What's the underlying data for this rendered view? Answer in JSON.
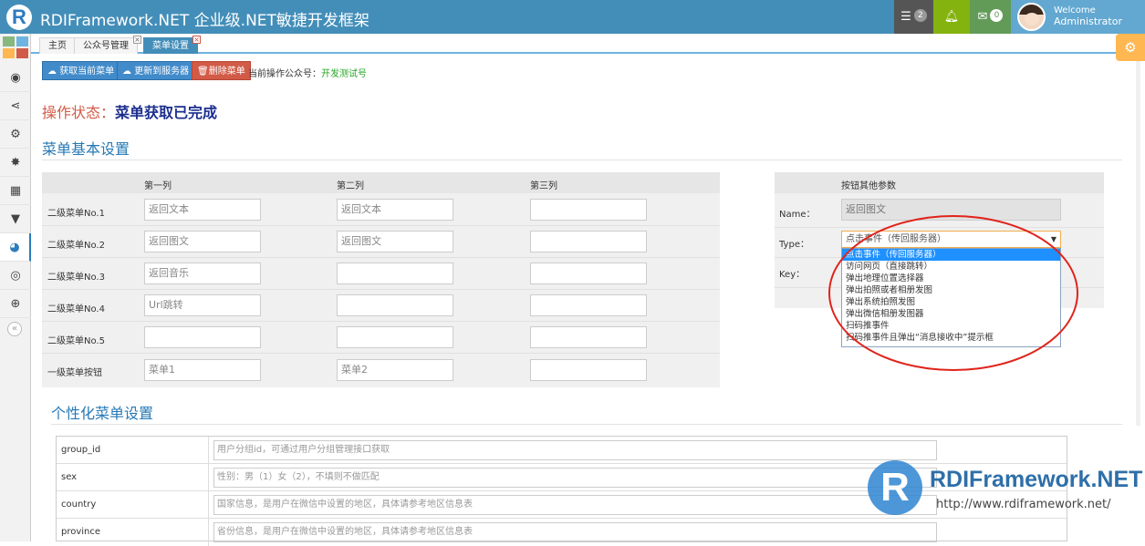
{
  "app": {
    "logo_letter": "R",
    "title": "RDIFramework.NET 企业级.NET敏捷开发框架"
  },
  "navbar": {
    "tasks_icon": "tasks-icon",
    "tasks_count": "2",
    "bell_icon": "bell-icon",
    "mail_icon": "envelope-icon",
    "mail_count": "0",
    "user_welcome": "Welcome",
    "user_name": "Administrator"
  },
  "sidebar": {
    "icons": [
      "dashboard-icon",
      "share-icon",
      "cogs-icon",
      "spinner-icon",
      "calendar-icon",
      "filter-icon",
      "wechat-icon",
      "eye-icon",
      "globe-icon"
    ],
    "collapse_glyph": "«"
  },
  "tabs": [
    {
      "label": "主页"
    },
    {
      "label": "公众号管理"
    },
    {
      "label": "菜单设置"
    }
  ],
  "toolbar": {
    "fetch_label": "获取当前菜单",
    "update_label": "更新到服务器",
    "delete_label": "删除菜单",
    "current_account_label": "当前操作公众号：",
    "current_account_value": "开发测试号"
  },
  "status": {
    "label": "操作状态：",
    "value": "菜单获取已完成"
  },
  "menu_section": {
    "title": "菜单基本设置",
    "columns": [
      "第一列",
      "第二列",
      "第三列"
    ],
    "rows": [
      {
        "label": "二级菜单No.1",
        "cells": [
          "返回文本",
          "返回文本",
          ""
        ]
      },
      {
        "label": "二级菜单No.2",
        "cells": [
          "返回图文",
          "返回图文",
          ""
        ]
      },
      {
        "label": "二级菜单No.3",
        "cells": [
          "返回音乐",
          "",
          ""
        ]
      },
      {
        "label": "二级菜单No.4",
        "cells": [
          "Url跳转",
          "",
          ""
        ]
      },
      {
        "label": "二级菜单No.5",
        "cells": [
          "",
          "",
          ""
        ]
      },
      {
        "label": "一级菜单按钮",
        "cells": [
          "菜单1",
          "菜单2",
          ""
        ]
      }
    ]
  },
  "params": {
    "title": "按钮其他参数",
    "name_label": "Name：",
    "name_value": "返回图文",
    "type_label": "Type：",
    "type_value": "点击事件（传回服务器）",
    "key_label": "Key：",
    "options": [
      "点击事件（传回服务器）",
      "访问网页（直接跳转）",
      "弹出地理位置选择器",
      "弹出拍照或者相册发图",
      "弹出系统拍照发图",
      "弹出微信相册发图器",
      "扫码推事件",
      "扫码推事件且弹出“消息接收中”提示框"
    ]
  },
  "personal_section": {
    "title": "个性化菜单设置",
    "rows": [
      {
        "label": "group_id",
        "placeholder": "用户分组id，可通过用户分组管理接口获取"
      },
      {
        "label": "sex",
        "placeholder": "性别：男（1）女（2），不填则不做匹配"
      },
      {
        "label": "country",
        "placeholder": "国家信息，是用户在微信中设置的地区，具体请参考地区信息表"
      },
      {
        "label": "province",
        "placeholder": "省份信息，是用户在微信中设置的地区，具体请参考地区信息表"
      }
    ]
  },
  "watermark": {
    "brand": "RDIFramework.NET",
    "url": "http://www.rdiframework.net/"
  }
}
